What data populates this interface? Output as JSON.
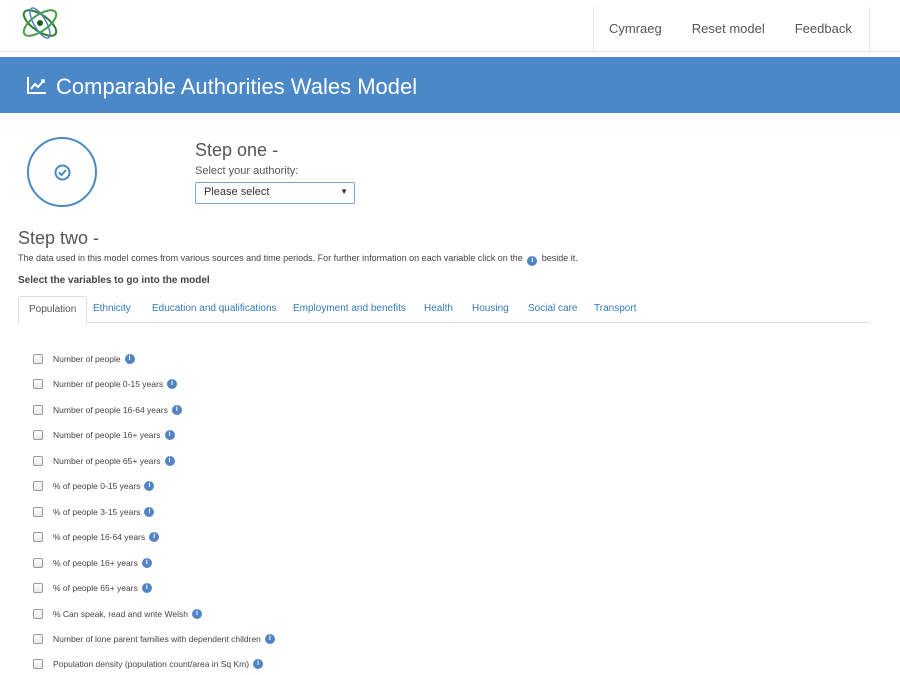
{
  "nav": {
    "links": [
      "Cymraeg",
      "Reset model",
      "Feedback"
    ]
  },
  "banner": {
    "title": "Comparable Authorities Wales Model",
    "icon": "line-chart-icon"
  },
  "step_one": {
    "title": "Step one -",
    "subtitle": "Select your authority:",
    "select_value": "Please select"
  },
  "step_two": {
    "title": "Step two -",
    "desc_before": "The data used in this model comes from various sources and time periods. For further information on each variable click on the",
    "desc_after": "beside it.",
    "select_label": "Select the variables to go into the model"
  },
  "tabs": [
    "Population",
    "Ethnicity",
    "Education and qualifications",
    "Employment and benefits",
    "Health",
    "Housing",
    "Social care",
    "Transport"
  ],
  "active_tab": "Population",
  "variables": [
    "Number of people",
    "Number of people 0-15 years",
    "Number of people 16-64 years",
    "Number of people 16+ years",
    "Number of people 65+ years",
    "% of people 0-15 years",
    "% of people 3-15 years",
    "% of people 16-64 years",
    "% of people 16+ years",
    "% of people 65+ years",
    "% Can speak, read and write Welsh",
    "Number of lone parent families with dependent children",
    "Population density (population count/area in Sq Km)"
  ],
  "colors": {
    "banner": "#4a88c8",
    "link": "#337ab7",
    "info": "#5283c4"
  }
}
